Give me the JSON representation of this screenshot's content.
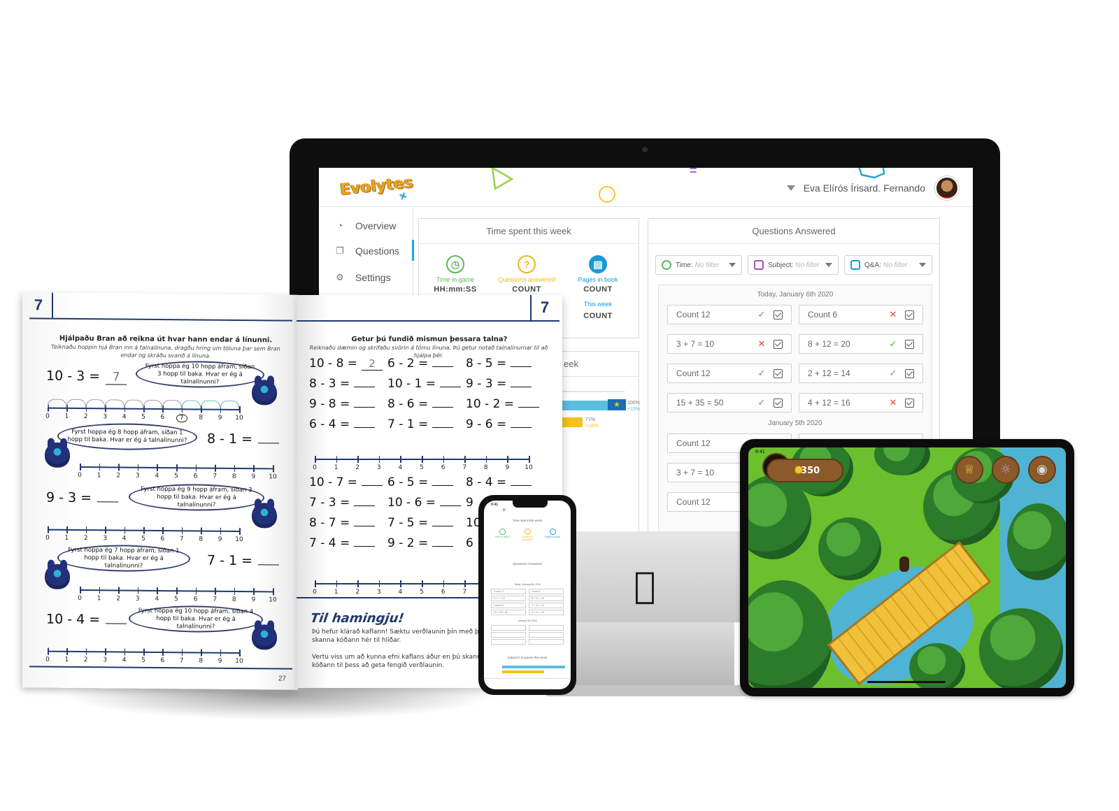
{
  "dashboard": {
    "logo": "Evolytes",
    "user_name": "Eva Elírós Írisard. Fernando",
    "nav": [
      {
        "label": "Overview",
        "icon": "speedometer-icon"
      },
      {
        "label": "Questions",
        "icon": "questions-icon"
      },
      {
        "label": "Settings",
        "icon": "gear-icon"
      }
    ],
    "time_panel": {
      "title": "Time spent this week",
      "stats": [
        {
          "label": "Time in game",
          "value": "HH:mm:SS",
          "color": "#5cb85c",
          "icon": "clock-icon"
        },
        {
          "label": "Questions answered",
          "value": "COUNT",
          "color": "#f0b71b",
          "icon": "question-icon"
        },
        {
          "label": "Pages in book",
          "value": "COUNT",
          "color": "#1a9ad6",
          "icon": "book-icon"
        },
        {
          "label": "This week",
          "value": "COUNT",
          "color": "#1a9ad6"
        }
      ]
    },
    "progress_fragment": {
      "title_tail": "eek",
      "rows": [
        {
          "percent": "100%",
          "change": "+15%",
          "bar_color": "#5bbde0",
          "fill": 1.0
        },
        {
          "percent": "71%",
          "change": "+18%",
          "bar_color": "#f6c21a",
          "fill": 0.71
        }
      ]
    },
    "questions_panel": {
      "title": "Questions Answered",
      "filters": [
        {
          "name": "Time:",
          "value": "No filter",
          "color": "#5cb85c"
        },
        {
          "name": "Subject:",
          "value": "No filter",
          "color": "#9b59b6"
        },
        {
          "name": "Q&A:",
          "value": "No filter",
          "color": "#1a9ad6"
        }
      ],
      "groups": [
        {
          "date": "Today, January 6th 2020",
          "cards": [
            {
              "text": "Count 12",
              "correct": true
            },
            {
              "text": "Count 6",
              "correct": false
            },
            {
              "text": "3 + 7 = 10",
              "correct": false
            },
            {
              "text": "8 + 12 = 20",
              "correct": true
            },
            {
              "text": "Count 12",
              "correct": true
            },
            {
              "text": "2 + 12 = 14",
              "correct": true
            },
            {
              "text": "15 + 35 = 50",
              "correct": true
            },
            {
              "text": "4 + 12 = 16",
              "correct": false
            }
          ]
        },
        {
          "date": "January 5th 2020",
          "cards": [
            {
              "text": "Count 12"
            },
            {
              "text": "3 + 7 = 10"
            },
            {
              "text": "Count 12"
            }
          ]
        }
      ],
      "check_mark": "✓",
      "cross_mark": "✕"
    }
  },
  "workbook": {
    "chapter": "7",
    "left": {
      "heading": "Hjálpaðu Bran að reikna út hvar hann endar á línunni.",
      "instructions": "Teiknaðu hoppin hjá Bran inn á talnalínuna, dragðu hring um töluna þar sem Bran endar og skráðu svarið á línuna.",
      "problems": [
        {
          "expr": "10 - 3 =",
          "answer": "7",
          "bubble": "Fyrst hoppa ég 10 hopp áfram, síðan 3 hopp til baka. Hvar er ég á talnalínunni?"
        },
        {
          "expr": "8 - 1 =",
          "answer": "",
          "bubble": "Fyrst hoppa ég 8 hopp áfram, síðan 1 hopp til baka. Hvar er ég á talnalínunni?"
        },
        {
          "expr": "9 - 3 =",
          "answer": "",
          "bubble": "Fyrst hoppa ég 9 hopp áfram, síðan 3 hopp til baka. Hvar er ég á talnalínunni?"
        },
        {
          "expr": "7 - 1 =",
          "answer": "",
          "bubble": "Fyrst hoppa ég 7 hopp áfram, síðan 1 hopp til baka. Hvar er ég á talnalínunni?"
        },
        {
          "expr": "10 - 4 =",
          "answer": "",
          "bubble": "Fyrst hoppa ég 10 hopp áfram, síðan 4 hopp til baka. Hvar er ég á talnalínunni?"
        }
      ],
      "page_number": "27",
      "number_line": [
        "0",
        "1",
        "2",
        "3",
        "4",
        "5",
        "6",
        "7",
        "8",
        "9",
        "10"
      ]
    },
    "right": {
      "heading": "Getur þú fundið mismun þessara talna?",
      "instructions": "Reiknaðu dæmin og skrifaðu svörin á tómu línuna. Þú getur notað talnalínurnar til að hjálpa þér.",
      "grid1": [
        [
          "10 - 8 =",
          "2"
        ],
        [
          "6 - 2 =",
          ""
        ],
        [
          "8 - 5 =",
          ""
        ],
        [
          "8 - 3 =",
          ""
        ],
        [
          "10 - 1 =",
          ""
        ],
        [
          "9 - 3 =",
          ""
        ],
        [
          "9 - 8 =",
          ""
        ],
        [
          "8 - 6 =",
          ""
        ],
        [
          "10 - 2 =",
          ""
        ],
        [
          "6 - 4 =",
          ""
        ],
        [
          "7 - 1 =",
          ""
        ],
        [
          "9 - 6 =",
          ""
        ]
      ],
      "grid2": [
        [
          "10 - 7 =",
          ""
        ],
        [
          "6 - 5 =",
          ""
        ],
        [
          "8 - 4 =",
          ""
        ],
        [
          "7 - 3 =",
          ""
        ],
        [
          "10 - 6 =",
          ""
        ],
        [
          "9",
          ""
        ],
        [
          "8 - 7 =",
          ""
        ],
        [
          "7 - 5 =",
          ""
        ],
        [
          "10",
          ""
        ],
        [
          "7 - 4 =",
          ""
        ],
        [
          "9 - 2 =",
          ""
        ],
        [
          "6",
          ""
        ]
      ],
      "congrats_title": "Til hamingju!",
      "congrats_text": "Þú hefur klárað kaflann! Sæktu verðlaunin þín með því að skanna kóðann hér til hliðar.",
      "congrats_note": "Vertu viss um að kunna efni kaflans áður en þú skannar kóðann til þess að geta fengið verðlaunin."
    }
  },
  "phone": {
    "time": "9:41",
    "section_time": "Time spent this week",
    "section_questions": "Questions Answered",
    "section_progress": "Subject's progress this week",
    "stats": [
      "Time in game",
      "Questions answered",
      "Pages in book"
    ],
    "date1": "Today, January 6th 2020",
    "date2": "January 5th 2020"
  },
  "tablet": {
    "coins": "1350",
    "time": "9:41"
  }
}
